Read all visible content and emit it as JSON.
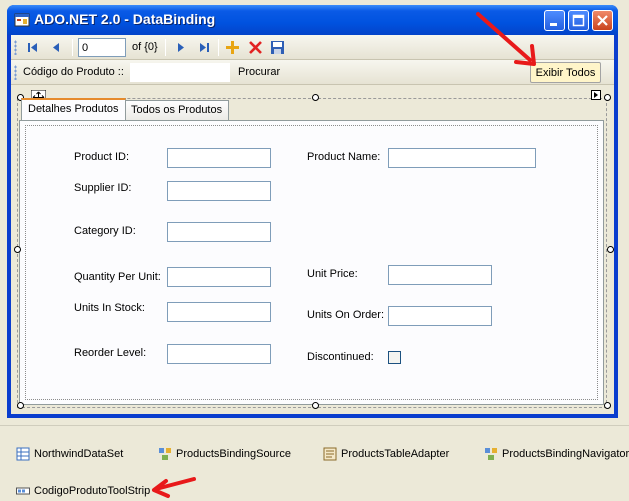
{
  "window": {
    "title": "ADO.NET 2.0 - DataBinding",
    "controls": [
      "minimize-button",
      "maximize-button",
      "close-button"
    ]
  },
  "navigator": {
    "position_value": "0",
    "count_text": "of {0}",
    "buttons": [
      "move-first",
      "move-previous",
      "move-next",
      "move-last",
      "add-new",
      "delete",
      "save"
    ]
  },
  "search_strip": {
    "label": "Código do Produto ::",
    "input_value": "",
    "search_label": "Procurar",
    "show_all_label": "Exibir Todos"
  },
  "tabs": [
    {
      "label": "Detalhes Produtos",
      "active": true
    },
    {
      "label": "Todos os Produtos",
      "active": false
    }
  ],
  "form": {
    "product_id": {
      "label": "Product ID:",
      "value": ""
    },
    "product_name": {
      "label": "Product Name:",
      "value": ""
    },
    "supplier_id": {
      "label": "Supplier ID:",
      "value": ""
    },
    "category_id": {
      "label": "Category ID:",
      "value": ""
    },
    "quantity_per_unit": {
      "label": "Quantity Per Unit:",
      "value": ""
    },
    "unit_price": {
      "label": "Unit Price:",
      "value": ""
    },
    "units_in_stock": {
      "label": "Units In Stock:",
      "value": ""
    },
    "units_on_order": {
      "label": "Units On Order:",
      "value": ""
    },
    "reorder_level": {
      "label": "Reorder Level:",
      "value": ""
    },
    "discontinued": {
      "label": "Discontinued:",
      "checked": false
    }
  },
  "component_tray": [
    {
      "label": "NorthwindDataSet",
      "icon": "dataset-icon"
    },
    {
      "label": "ProductsBindingSource",
      "icon": "binding-source-icon"
    },
    {
      "label": "ProductsTableAdapter",
      "icon": "table-adapter-icon"
    },
    {
      "label": "ProductsBindingNavigator",
      "icon": "binding-navigator-icon"
    },
    {
      "label": "CodigoProdutoToolStrip",
      "icon": "toolstrip-icon"
    }
  ],
  "colors": {
    "titlebar": "#0052df",
    "annotation_arrow": "#e8191a",
    "highlight_button": "#fff5c9",
    "tab_accent": "#e68b2c"
  }
}
